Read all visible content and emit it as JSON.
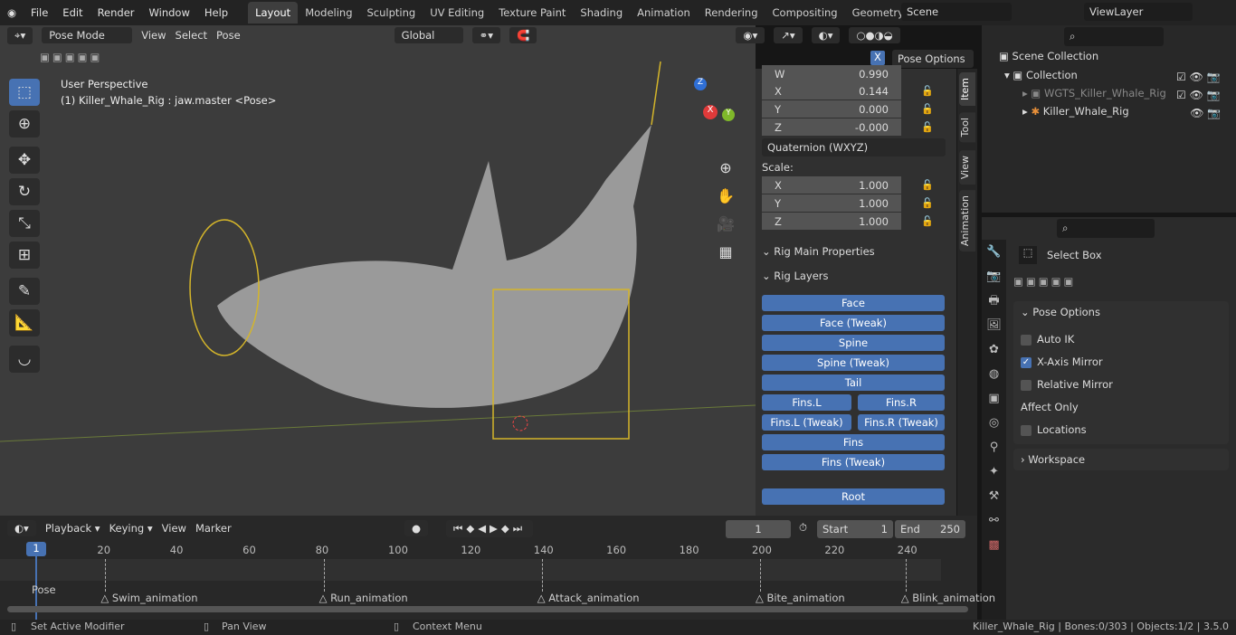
{
  "menu": [
    "File",
    "Edit",
    "Render",
    "Window",
    "Help"
  ],
  "workspaces": [
    "Layout",
    "Modeling",
    "Sculpting",
    "UV Editing",
    "Texture Paint",
    "Shading",
    "Animation",
    "Rendering",
    "Compositing",
    "Geometry Noc"
  ],
  "scene": "Scene",
  "view_layer": "ViewLayer",
  "viewport": {
    "mode": "Pose Mode",
    "menus": [
      "View",
      "Select",
      "Pose"
    ],
    "orientation": "Global",
    "perspective": "User Perspective",
    "object_info": "(1) Killer_Whale_Rig : jaw.master <Pose>",
    "pose_options": "Pose Options",
    "mirror_x": "X"
  },
  "npanel": {
    "rotation": [
      {
        "axis": "W",
        "value": "0.990"
      },
      {
        "axis": "X",
        "value": "0.144"
      },
      {
        "axis": "Y",
        "value": "0.000"
      },
      {
        "axis": "Z",
        "value": "-0.000"
      }
    ],
    "rotation_mode": "Quaternion (WXYZ)",
    "scale_label": "Scale:",
    "scale": [
      {
        "axis": "X",
        "value": "1.000"
      },
      {
        "axis": "Y",
        "value": "1.000"
      },
      {
        "axis": "Z",
        "value": "1.000"
      }
    ],
    "rig_main": "Rig Main Properties",
    "rig_layers": "Rig Layers",
    "layers": {
      "face": "Face",
      "face_tweak": "Face (Tweak)",
      "spine": "Spine",
      "spine_tweak": "Spine (Tweak)",
      "tail": "Tail",
      "fins_l": "Fins.L",
      "fins_r": "Fins.R",
      "fins_l_tweak": "Fins.L (Tweak)",
      "fins_r_tweak": "Fins.R (Tweak)",
      "fins": "Fins",
      "fins_tweak": "Fins (Tweak)",
      "root": "Root"
    },
    "tabs": [
      "Item",
      "Tool",
      "View",
      "Animation"
    ]
  },
  "outliner": {
    "scene_collection": "Scene Collection",
    "collection": "Collection",
    "items": [
      "WGTS_Killer_Whale_Rig",
      "Killer_Whale_Rig"
    ]
  },
  "properties": {
    "tool": "Select Box",
    "pose_options": "Pose Options",
    "auto_ik": "Auto IK",
    "x_mirror": "X-Axis Mirror",
    "relative_mirror": "Relative Mirror",
    "affect_only": "Affect Only",
    "locations": "Locations",
    "workspace": "Workspace",
    "x_mirror_checked": true
  },
  "timeline": {
    "menus": [
      "Playback",
      "Keying",
      "View",
      "Marker"
    ],
    "current_frame": "1",
    "start_label": "Start",
    "start": "1",
    "end_label": "End",
    "end": "250",
    "ticks": [
      "20",
      "40",
      "60",
      "80",
      "100",
      "120",
      "140",
      "160",
      "180",
      "200",
      "220",
      "240"
    ],
    "markers": [
      {
        "label": "Pose",
        "frame": 1
      },
      {
        "label": "Swim_animation",
        "frame": 20
      },
      {
        "label": "Run_animation",
        "frame": 80
      },
      {
        "label": "Attack_animation",
        "frame": 140
      },
      {
        "label": "Bite_animation",
        "frame": 200
      },
      {
        "label": "Blink_animation",
        "frame": 240
      }
    ]
  },
  "status": {
    "left": "Set Active Modifier",
    "mid": "Pan View",
    "right": "Context Menu",
    "info": "Killer_Whale_Rig | Bones:0/303 | Objects:1/2 | 3.5.0"
  },
  "colors": {
    "accent": "#4772b3",
    "viewport_bg": "#3c3c3c"
  }
}
